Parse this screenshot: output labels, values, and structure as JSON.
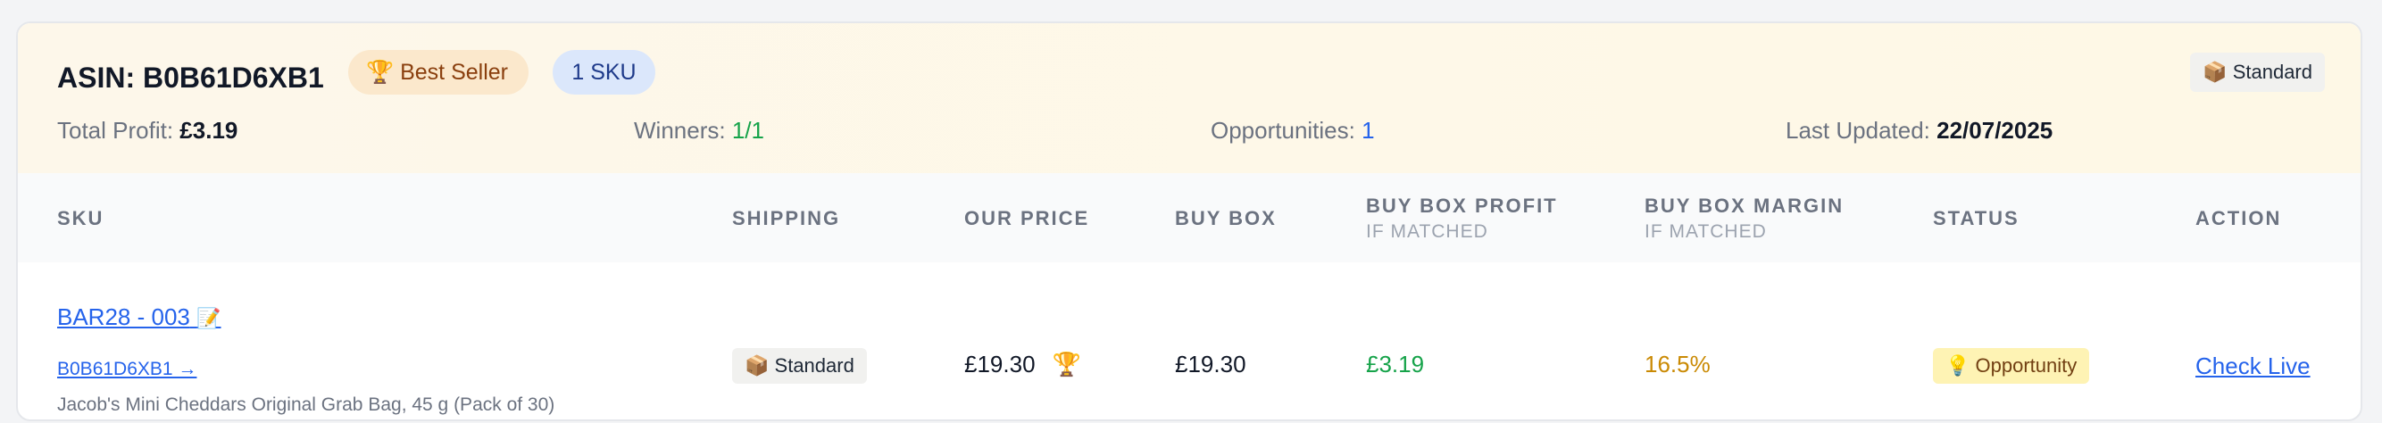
{
  "header": {
    "asin_title": "ASIN: B0B61D6XB1",
    "best_seller_icon": "trophy-icon",
    "best_seller_icon_glyph": "🏆",
    "best_seller_label": "Best Seller",
    "sku_count_label": "1 SKU",
    "shipping_icon": "package-icon",
    "shipping_icon_glyph": "📦",
    "shipping_label": "Standard",
    "stats": {
      "total_profit_label": "Total Profit:",
      "total_profit_value": "£3.19",
      "winners_label": "Winners:",
      "winners_value": "1/1",
      "opportunities_label": "Opportunities:",
      "opportunities_value": "1",
      "last_updated_label": "Last Updated:",
      "last_updated_value": "22/07/2025"
    }
  },
  "table": {
    "columns": {
      "sku": "SKU",
      "shipping": "SHIPPING",
      "our_price": "OUR PRICE",
      "buy_box": "BUY BOX",
      "buy_box_profit": "BUY BOX PROFIT",
      "buy_box_profit_sub": "IF MATCHED",
      "buy_box_margin": "BUY BOX MARGIN",
      "buy_box_margin_sub": "IF MATCHED",
      "status": "STATUS",
      "action": "ACTION"
    },
    "rows": [
      {
        "sku": "BAR28 - 003",
        "sku_icon": "memo-icon",
        "sku_icon_glyph": "📝",
        "asin_link": "B0B61D6XB1 →",
        "description": "Jacob's Mini Cheddars Original Grab Bag, 45 g (Pack of 30)",
        "shipping_icon_glyph": "📦",
        "shipping": "Standard",
        "our_price": "£19.30",
        "our_price_icon_glyph": "🏆",
        "buy_box": "£19.30",
        "buy_box_profit": "£3.19",
        "buy_box_margin": "16.5%",
        "status_icon_glyph": "💡",
        "status": "Opportunity",
        "action": "Check Live"
      }
    ]
  },
  "colors": {
    "header_bg": "#fdf7ea",
    "green": "#16a34a",
    "blue": "#2563eb",
    "amber": "#ca8a04",
    "best_seller_bg": "#fbe8cc",
    "sku_pill_bg": "#dbe7fb",
    "status_bg": "#fef3b4"
  }
}
